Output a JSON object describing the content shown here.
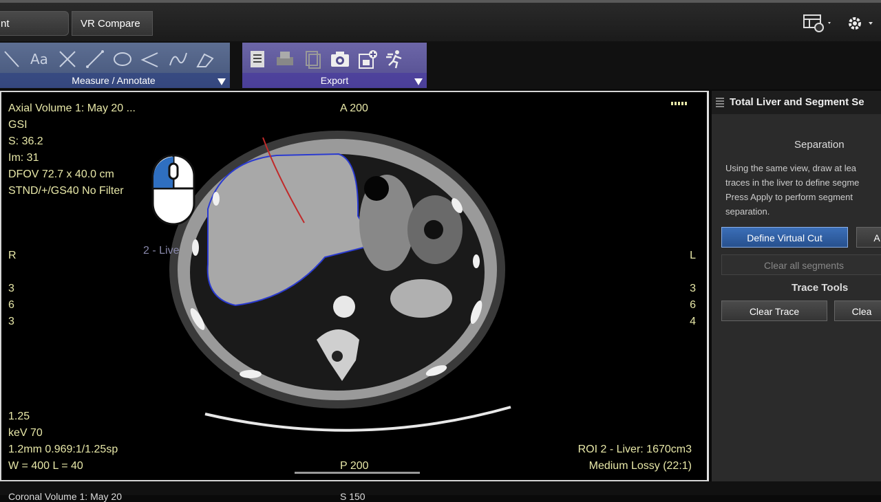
{
  "tabs": [
    {
      "label": "nt Separation"
    },
    {
      "label": "VR Compare"
    }
  ],
  "toolbar": {
    "measure_label": "Measure / Annotate",
    "export_label": "Export",
    "measure_icons": [
      "arrow-tool-icon",
      "text-annotation-icon",
      "cross-cursor-icon",
      "line-measure-icon",
      "ellipse-roi-icon",
      "angle-tool-icon",
      "freehand-roi-icon",
      "erase-annotation-icon"
    ],
    "export_icons": [
      "report-icon",
      "print-icon",
      "copy-icon",
      "camera-icon",
      "save-series-icon",
      "export-run-icon"
    ]
  },
  "viewer": {
    "top_left": [
      "Axial Volume 1: May 20 ...",
      "GSI",
      "S: 36.2",
      "Im: 31",
      "DFOV 72.7 x 40.0 cm",
      "STND/+/GS40 No Filter"
    ],
    "bottom_left": [
      "1.25",
      "keV 70",
      "1.2mm 0.969:1/1.25sp",
      "W = 400 L = 40"
    ],
    "roi_text": "ROI 2 - Liver: 1670cm3",
    "compression_text": "Medium Lossy (22:1)",
    "orient_top": "A 200",
    "orient_bottom": "P 200",
    "orient_left": "R",
    "orient_right": "L",
    "left_nums": [
      "3",
      "6",
      "3"
    ],
    "right_nums": [
      "3",
      "6",
      "4"
    ],
    "liver_label": "2 - Live"
  },
  "panel": {
    "title": "Total Liver and Segment Se",
    "separation_title": "Separation",
    "instructions": [
      "Using the same view, draw at lea",
      "traces in the liver to define segme",
      "Press Apply to perform segment",
      "separation."
    ],
    "define_virtual_cut": "Define Virtual Cut",
    "apply": "A",
    "clear_all_segments": "Clear all segments",
    "trace_tools_title": "Trace Tools",
    "clear_trace": "Clear Trace",
    "clear_partial": "Clea"
  },
  "bottom_strip": {
    "left_text": "Coronal Volume 1: May 20",
    "mid_text": "S 150"
  },
  "colors": {
    "overlay_text": "#e8e8a8",
    "liver_contour": "#2a3ad0",
    "define_button": "#3b6fb8"
  }
}
